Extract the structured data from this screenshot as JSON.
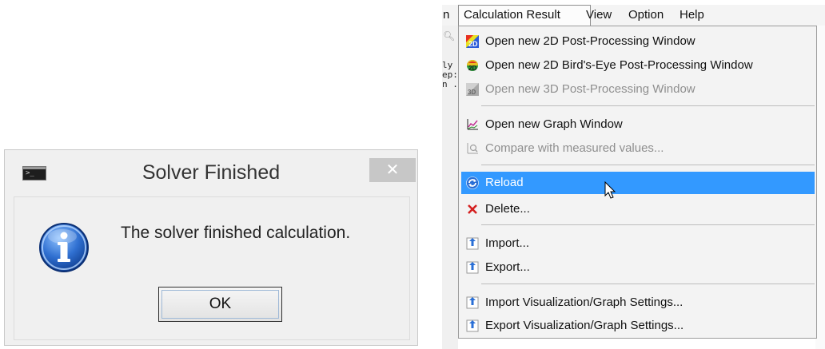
{
  "dialog": {
    "title": "Solver Finished",
    "close_glyph": "✕",
    "message": "The solver finished calculation.",
    "ok_label": "OK",
    "app_icon": "console-icon",
    "message_icon": "info-icon"
  },
  "menubar": {
    "items": [
      "n",
      "Calculation Result",
      "View",
      "Option",
      "Help"
    ],
    "open_menu": "Calculation Result"
  },
  "background": {
    "text_lines": [
      "ly",
      "ep:",
      "n ."
    ]
  },
  "menu": {
    "items": [
      {
        "label": "Open new 2D Post-Processing Window",
        "icon": "2d-postprocessing-icon",
        "enabled": true
      },
      {
        "label": "Open new 2D Bird's-Eye Post-Processing Window",
        "icon": "2d-birdseye-icon",
        "enabled": true
      },
      {
        "label": "Open new 3D Post-Processing Window",
        "icon": "3d-postprocessing-icon",
        "enabled": false
      },
      {
        "label": "Open new Graph Window",
        "icon": "graph-icon",
        "enabled": true
      },
      {
        "label": "Compare with measured values...",
        "icon": "compare-icon",
        "enabled": false
      },
      {
        "label": "Reload",
        "icon": "reload-icon",
        "enabled": true,
        "highlighted": true
      },
      {
        "label": "Delete...",
        "icon": "delete-icon",
        "enabled": true
      },
      {
        "label": "Import...",
        "icon": "import-icon",
        "enabled": true
      },
      {
        "label": "Export...",
        "icon": "export-icon",
        "enabled": true
      },
      {
        "label": "Import Visualization/Graph Settings...",
        "icon": "import-settings-icon",
        "enabled": true
      },
      {
        "label": "Export Visualization/Graph Settings...",
        "icon": "export-settings-icon",
        "enabled": true
      }
    ]
  },
  "colors": {
    "highlight": "#3399ff",
    "delete_red": "#d42020",
    "disabled_text": "#8f8f8f"
  }
}
